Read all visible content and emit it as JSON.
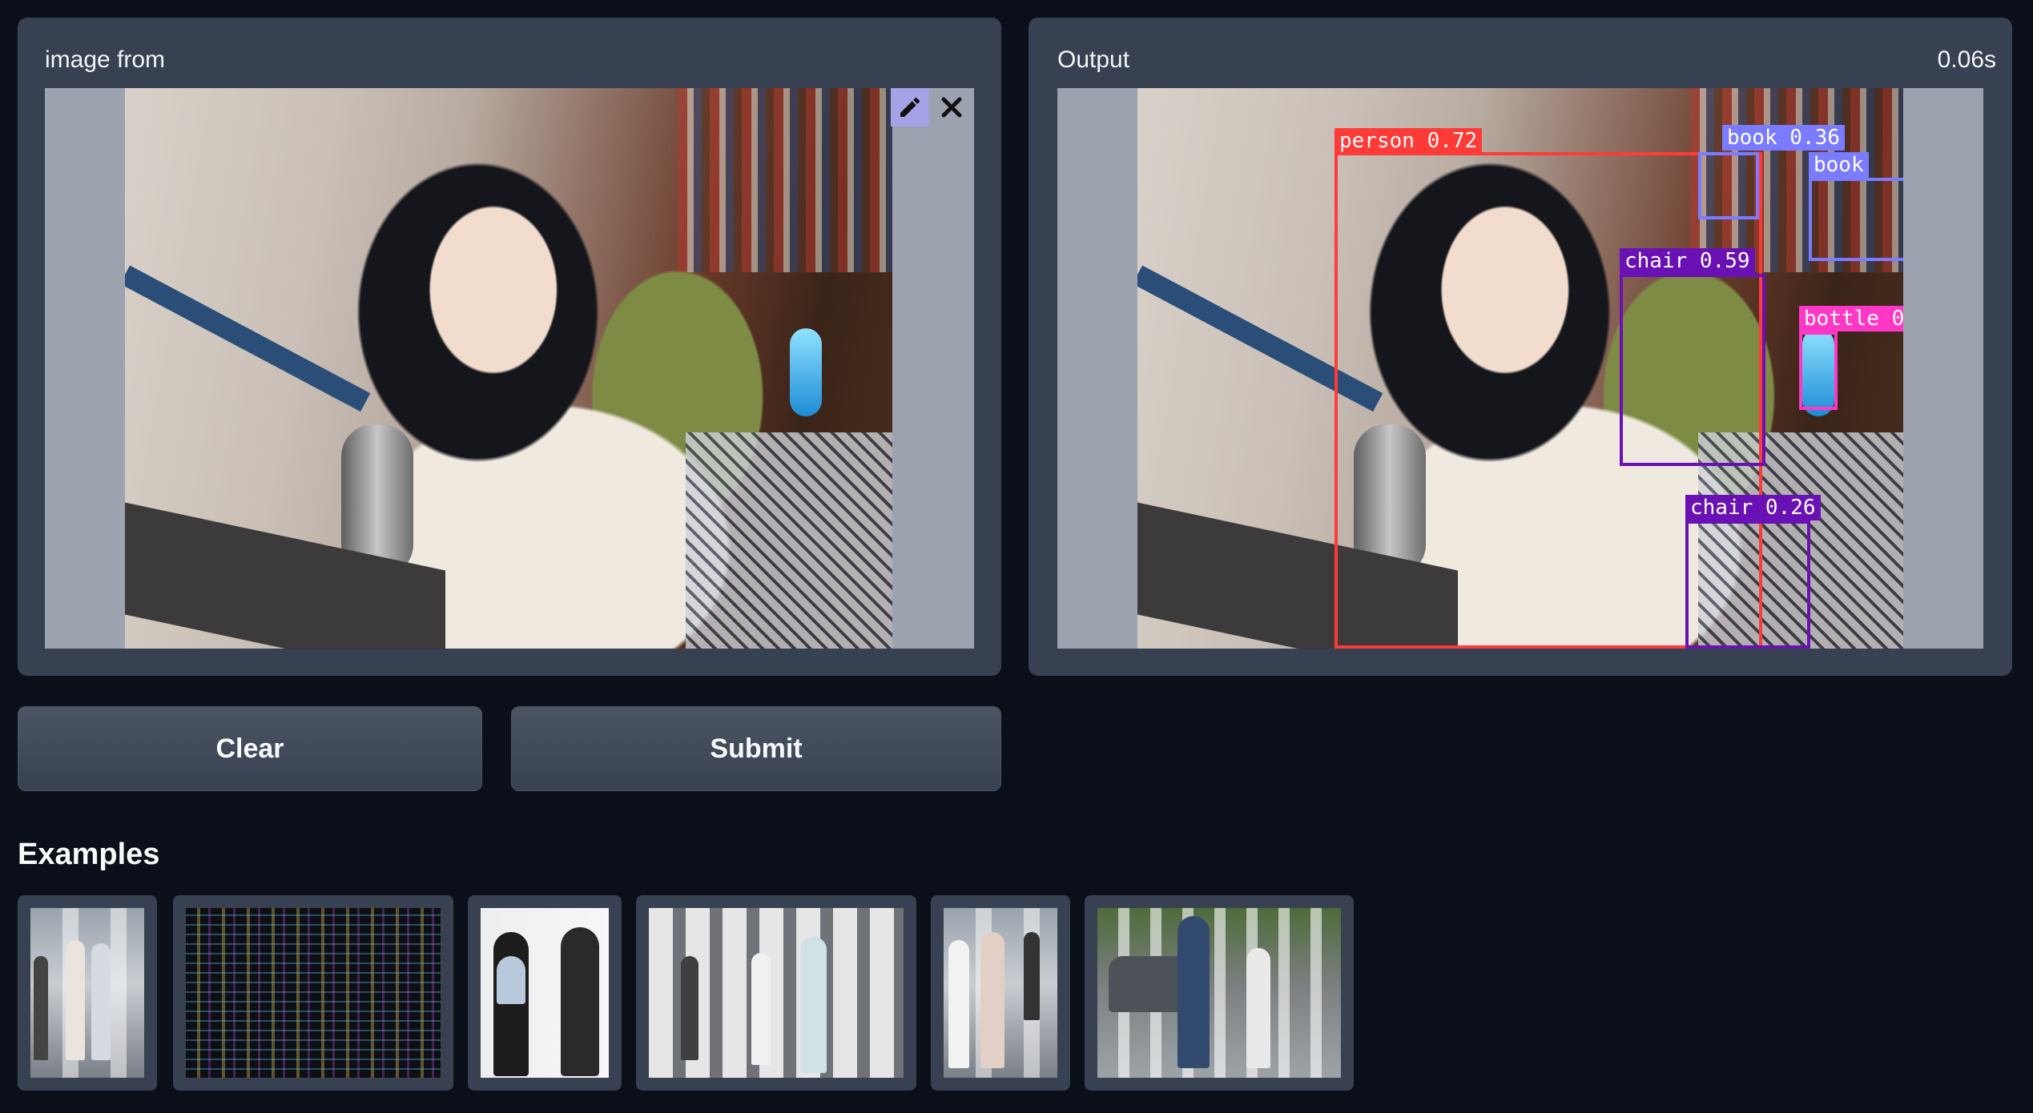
{
  "input_panel": {
    "label": "image from",
    "edit_icon": "pencil-icon",
    "close_icon": "close-icon"
  },
  "output_panel": {
    "label": "Output",
    "time": "0.06s",
    "detections": [
      {
        "label": "person 0.72",
        "color": "#ff3b38"
      },
      {
        "label": "book 0.36",
        "color": "#7b7bff"
      },
      {
        "label": "book",
        "color": "#7b7bff"
      },
      {
        "label": "chair 0.59",
        "color": "#6a11b5"
      },
      {
        "label": "bottle 0",
        "color": "#ff37c7"
      },
      {
        "label": "chair 0.26",
        "color": "#6a11b5"
      }
    ]
  },
  "buttons": {
    "clear": "Clear",
    "submit": "Submit"
  },
  "examples": {
    "title": "Examples"
  },
  "colors": {
    "background": "#0b0f19",
    "panel": "#374151",
    "image_padding": "#9ca3af"
  }
}
